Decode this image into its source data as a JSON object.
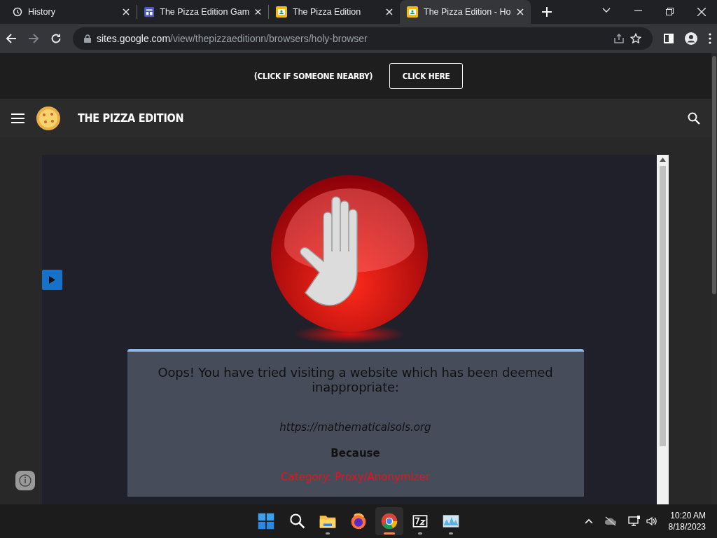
{
  "browser": {
    "tabs": [
      {
        "title": "History",
        "kind": "history",
        "selected": false
      },
      {
        "title": "The Pizza Edition Gam",
        "kind": "sites",
        "selected": false
      },
      {
        "title": "The Pizza Edition",
        "kind": "slides",
        "selected": false
      },
      {
        "title": "The Pizza Edition - Ho",
        "kind": "slides",
        "selected": true
      }
    ],
    "url_host": "sites.google.com",
    "url_path": "/view/thepizzaeditionn/browsers/holy-browser"
  },
  "site": {
    "banner_text": "(CLICK IF SOMEONE NEARBY)",
    "banner_button": "CLICK HERE",
    "title": "THE PIZZA EDITION"
  },
  "block_page": {
    "message": "Oops! You have tried visiting a website which has been deemed inappropriate:",
    "blocked_url": "https://mathematicalsols.org",
    "because": "Because",
    "category": "Category: Proxy/Anonymizer"
  },
  "taskbar": {
    "apps": [
      {
        "kind": "start",
        "active": false,
        "running": false
      },
      {
        "kind": "search",
        "active": false,
        "running": false
      },
      {
        "kind": "folder",
        "active": false,
        "running": true
      },
      {
        "kind": "firefox",
        "active": false,
        "running": false
      },
      {
        "kind": "chrome",
        "active": true,
        "running": true
      },
      {
        "kind": "archiver",
        "active": false,
        "running": true
      },
      {
        "kind": "monitor",
        "active": false,
        "running": true
      }
    ],
    "time": "10:20 AM",
    "date": "8/18/2023"
  }
}
